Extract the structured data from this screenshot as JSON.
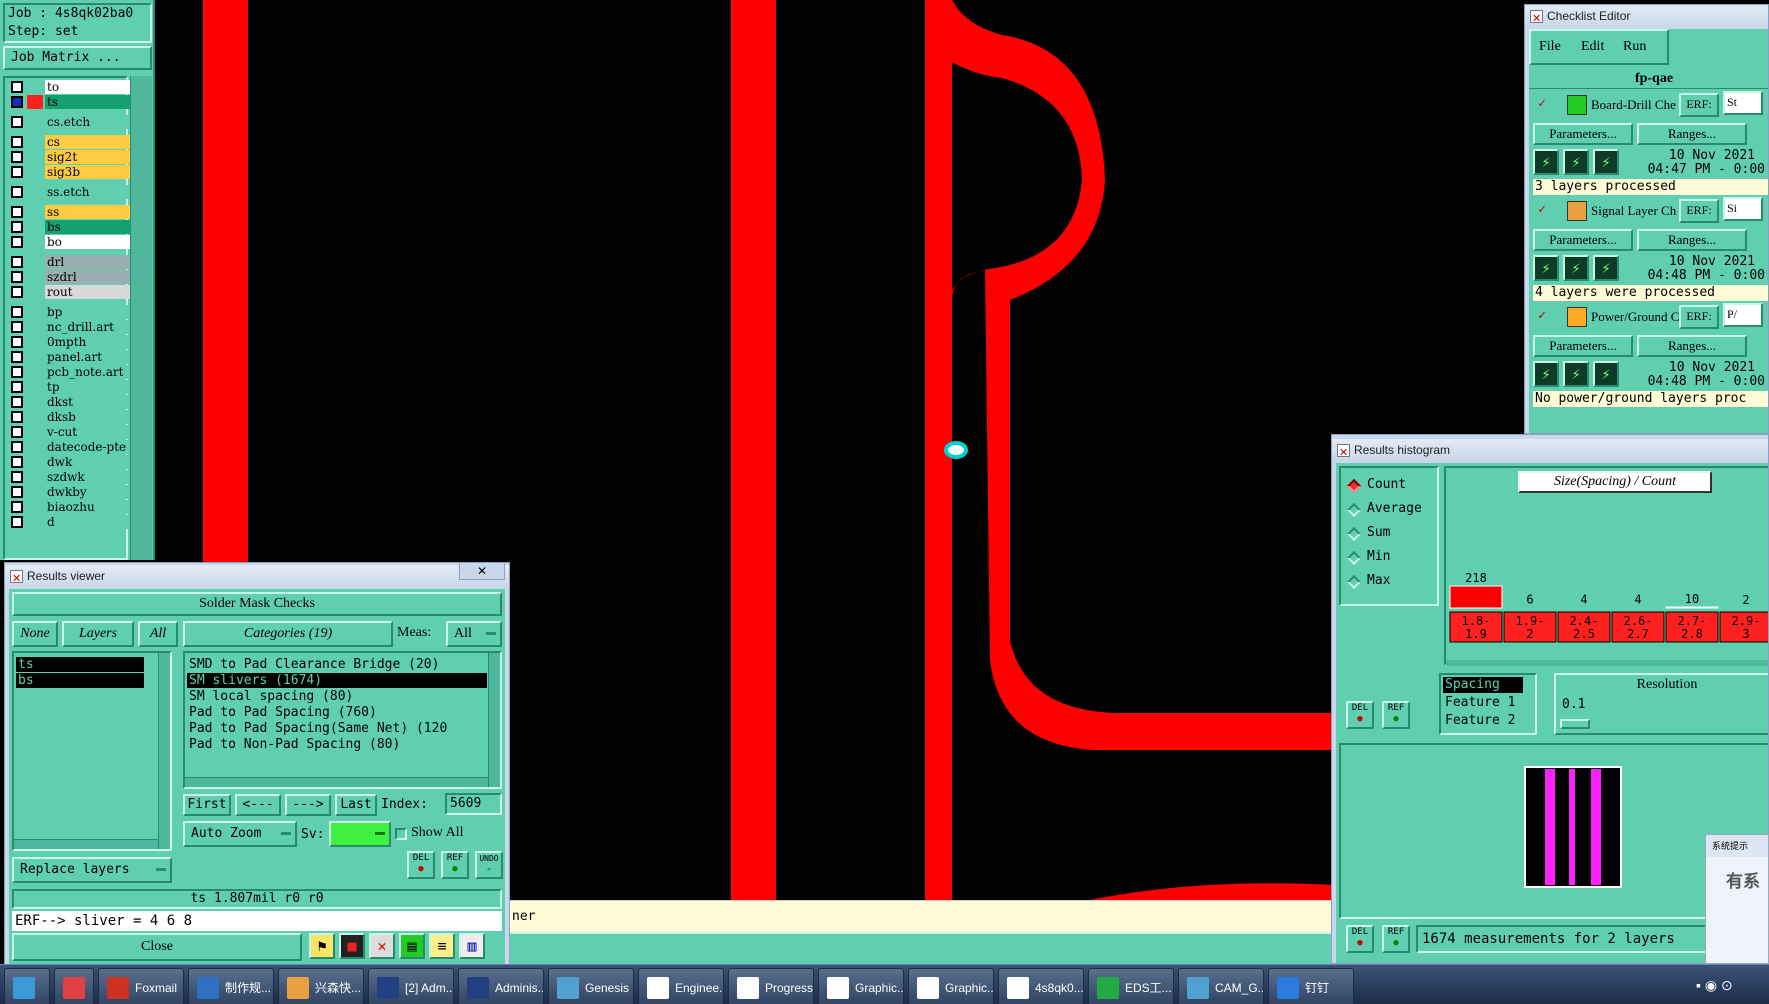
{
  "job_panel": {
    "job": "Job : 4s8qk02ba0",
    "step": "Step: set",
    "matrix_button": "Job Matrix ..."
  },
  "layers": [
    {
      "name": "to",
      "color": "#ffffff"
    },
    {
      "name": "ts",
      "color": "#14a070",
      "active": true
    },
    {
      "name": "cs.etch",
      "color": "#5fcfb0"
    },
    {
      "name": "cs",
      "color": "#ffcc44"
    },
    {
      "name": "sig2t",
      "color": "#ffcc44"
    },
    {
      "name": "sig3b",
      "color": "#ffcc44"
    },
    {
      "name": "ss.etch",
      "color": "#5fcfb0"
    },
    {
      "name": "ss",
      "color": "#ffcc44"
    },
    {
      "name": "bs",
      "color": "#14a070"
    },
    {
      "name": "bo",
      "color": "#ffffff"
    },
    {
      "name": "drl",
      "color": "#9ab0b0"
    },
    {
      "name": "szdrl",
      "color": "#9ab0b0"
    },
    {
      "name": "rout",
      "color": "#d8d8d8"
    },
    {
      "name": "bp",
      "color": "#5fcfb0"
    },
    {
      "name": "nc_drill.art",
      "color": "#5fcfb0"
    },
    {
      "name": "0mpth",
      "color": "#5fcfb0"
    },
    {
      "name": "panel.art",
      "color": "#5fcfb0"
    },
    {
      "name": "pcb_note.art",
      "color": "#5fcfb0"
    },
    {
      "name": "tp",
      "color": "#5fcfb0"
    },
    {
      "name": "dkst",
      "color": "#5fcfb0"
    },
    {
      "name": "dksb",
      "color": "#5fcfb0"
    },
    {
      "name": "v-cut",
      "color": "#5fcfb0"
    },
    {
      "name": "datecode-pte",
      "color": "#5fcfb0"
    },
    {
      "name": "dwk",
      "color": "#5fcfb0"
    },
    {
      "name": "szdwk",
      "color": "#5fcfb0"
    },
    {
      "name": "dwkby",
      "color": "#5fcfb0"
    },
    {
      "name": "biaozhu",
      "color": "#5fcfb0"
    },
    {
      "name": "d",
      "color": "#5fcfb0"
    }
  ],
  "results_viewer": {
    "title": "Results viewer",
    "header": "Solder Mask Checks",
    "none": "None",
    "layers": "Layers",
    "all": "All",
    "categories": "Categories (19)",
    "meas_label": "Meas:",
    "meas_value": "All",
    "layer_list": [
      "ts",
      "bs"
    ],
    "category_list": [
      "SMD to Pad Clearance Bridge (20)",
      "SM slivers (1674)",
      "SM local spacing (80)",
      "Pad to Pad Spacing (760)",
      "Pad to Pad Spacing(Same Net) (120",
      "Pad to Non-Pad Spacing (80)"
    ],
    "first": "First",
    "prev": "<---",
    "next": "--->",
    "last": "Last",
    "index_label": "Index:",
    "index_value": "5609",
    "auto_zoom": "Auto Zoom",
    "sv_label": "Sv:",
    "show_all": "Show All",
    "replace_layers": "Replace layers",
    "del": "DEL",
    "ref": "REF",
    "undo": "UNDO",
    "status": "ts 1.807mil  r0  r0",
    "erf": "ERF--> sliver = 4 6 8",
    "close": "Close"
  },
  "checklist": {
    "title": "Checklist Editor",
    "menu": [
      "File",
      "Edit",
      "Run"
    ],
    "name": "fp-qae",
    "erf": "ERF:",
    "params": "Parameters...",
    "ranges": "Ranges...",
    "items": [
      {
        "name": "Board-Drill Che",
        "side": "St",
        "date": "10 Nov 2021",
        "time": "04:47 PM - 0:00",
        "msg": "3 layers processed",
        "icon_color": "#22cc22"
      },
      {
        "name": "Signal Layer Ch",
        "side": "Si",
        "date": "10 Nov 2021",
        "time": "04:48 PM - 0:00",
        "msg": "4 layers were processed",
        "icon_color": "#e8a040"
      },
      {
        "name": "Power/Ground C",
        "side": "P/",
        "date": "10 Nov 2021",
        "time": "04:48 PM - 0:00",
        "msg": "No power/ground layers proc",
        "icon_color": "#ffaa22"
      }
    ]
  },
  "histogram": {
    "title": "Results histogram",
    "radios": [
      "Count",
      "Average",
      "Sum",
      "Min",
      "Max"
    ],
    "chart_title": "Size(Spacing) / Count",
    "counts": [
      "218",
      "6",
      "4",
      "4",
      "10",
      "2"
    ],
    "ranges": [
      [
        "1.8-",
        "1.9"
      ],
      [
        "1.9-",
        "2"
      ],
      [
        "2.4-",
        "2.5"
      ],
      [
        "2.6-",
        "2.7"
      ],
      [
        "2.7-",
        "2.8"
      ],
      [
        "2.9-",
        "3"
      ]
    ],
    "props": [
      "Spacing",
      "Feature 1",
      "Feature 2"
    ],
    "resolution_label": "Resolution",
    "resolution_value": "0.1",
    "del": "DEL",
    "ref": "REF",
    "status": "1674 measurements for 2 layers"
  },
  "chart_data": {
    "type": "bar",
    "title": "Size(Spacing) / Count",
    "categories": [
      "1.8-1.9",
      "1.9-2",
      "2.4-2.5",
      "2.6-2.7",
      "2.7-2.8",
      "2.9-3"
    ],
    "values": [
      218,
      6,
      4,
      4,
      10,
      2
    ]
  },
  "status_strip": {
    "text": "ner"
  },
  "notification": {
    "title": "系统提示",
    "body": "有系"
  },
  "taskbar": [
    {
      "label": "",
      "icon": "#3a9ad8",
      "width": 50
    },
    {
      "label": "",
      "icon": "#e04040",
      "width": 44
    },
    {
      "label": "Foxmail",
      "icon": "#d03020",
      "width": 90
    },
    {
      "label": "制作规...",
      "icon": "#3070c0",
      "width": 90
    },
    {
      "label": "兴森快...",
      "icon": "#e8a040",
      "width": 90
    },
    {
      "label": "[2] Adm...",
      "icon": "#204080",
      "width": 90
    },
    {
      "label": "Adminis...",
      "icon": "#204080",
      "width": 90
    },
    {
      "label": "Genesis",
      "icon": "#50a0d0",
      "width": 90
    },
    {
      "label": "Enginee...",
      "icon": "#ffffff",
      "width": 90
    },
    {
      "label": "Progress",
      "icon": "#ffffff",
      "width": 90
    },
    {
      "label": "Graphic...",
      "icon": "#ffffff",
      "width": 90
    },
    {
      "label": "Graphic...",
      "icon": "#ffffff",
      "width": 90
    },
    {
      "label": "4s8qk0...",
      "icon": "#ffffff",
      "width": 90
    },
    {
      "label": "EDS工...",
      "icon": "#22aa44",
      "width": 90
    },
    {
      "label": "CAM_G...",
      "icon": "#50a0d0",
      "width": 90
    },
    {
      "label": "钉钉",
      "icon": "#2a7ae0",
      "width": 90
    }
  ]
}
